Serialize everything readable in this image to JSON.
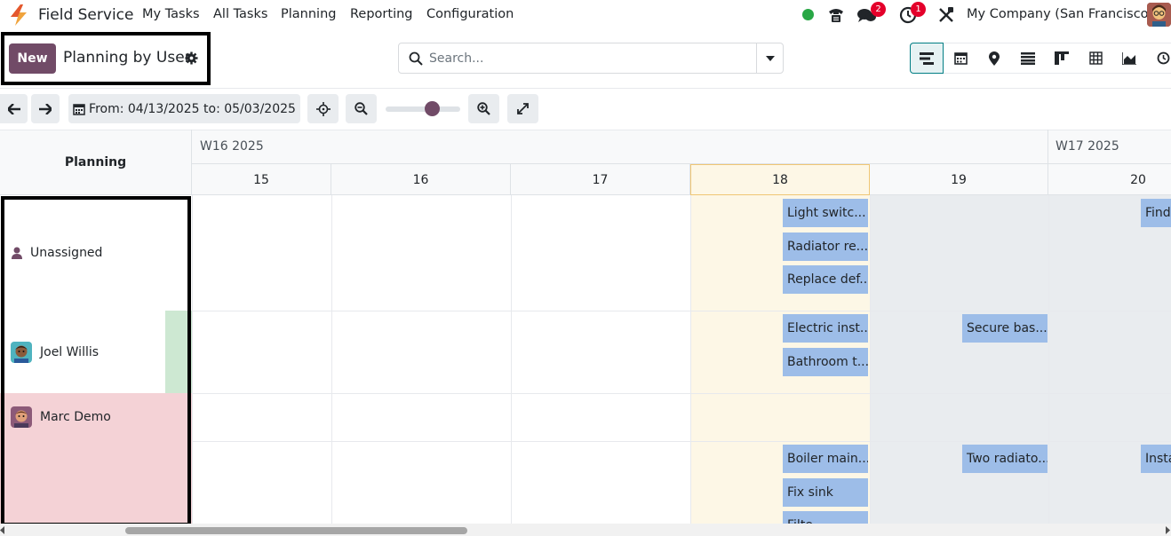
{
  "navbar": {
    "app_name": "Field Service",
    "menus": [
      "My Tasks",
      "All Tasks",
      "Planning",
      "Reporting",
      "Configuration"
    ],
    "messages_badge": "2",
    "activities_badge": "1",
    "company": "My Company (San Francisco)"
  },
  "control_panel": {
    "new_label": "New",
    "breadcrumb": "Planning by User",
    "search_placeholder": "Search..."
  },
  "toolbar": {
    "date_range": "From: 04/13/2025 to: 05/03/2025"
  },
  "gantt": {
    "row_header": "Planning",
    "weeks": [
      "W16 2025",
      "W17 2025"
    ],
    "days": [
      "15",
      "16",
      "17",
      "18",
      "19",
      "20"
    ],
    "rows": [
      {
        "label": "Unassigned"
      },
      {
        "label": "Joel Willis"
      },
      {
        "label": "Marc Demo"
      }
    ],
    "tasks": [
      {
        "label": "Light switc..."
      },
      {
        "label": "Radiator re..."
      },
      {
        "label": "Replace def..."
      },
      {
        "label": "Find"
      },
      {
        "label": "Electric inst..."
      },
      {
        "label": "Bathroom t..."
      },
      {
        "label": "Secure bas..."
      },
      {
        "label": "Boiler main..."
      },
      {
        "label": "Fix sink"
      },
      {
        "label": "Filte..."
      },
      {
        "label": "Two radiato..."
      },
      {
        "label": "Insta"
      }
    ]
  },
  "colors": {
    "brand": "#714b67",
    "task_pill": "#9dbde8",
    "today_column": "#fdf7e6",
    "weekend_column": "#e9ecef",
    "marc_demo_row": "#f4d2d6",
    "joel_availability": "#cde8d2"
  }
}
